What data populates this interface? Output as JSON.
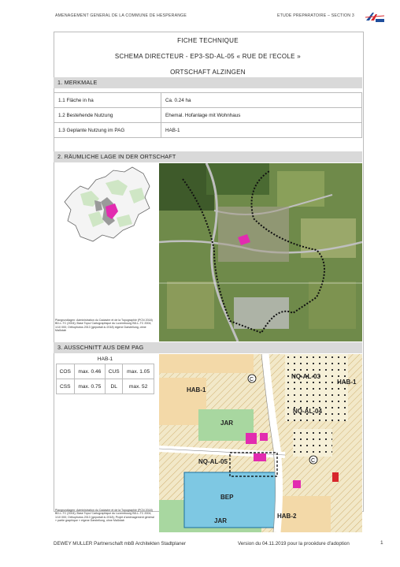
{
  "header": {
    "left": "AMENAGEMENT GENERAL DE LA COMMUNE DE HESPERANGE",
    "right": "ETUDE PREPARATOIRE – SECTION 3"
  },
  "title": {
    "line1": "FICHE TECHNIQUE",
    "line2": "SCHEMA DIRECTEUR - EP3-SD-AL-05 « RUE DE l'ECOLE »",
    "line3": "ORTSCHAFT ALZINGEN"
  },
  "sections": {
    "s1": "1. MERKMALE",
    "s2": "2. RÄUMLICHE LAGE IN DER ORTSCHAFT",
    "s3": "3. AUSSCHNITT AUS DEM PAG"
  },
  "merkmale": [
    {
      "label": "1.1 Fläche in ha",
      "value": "Ca. 0.24 ha"
    },
    {
      "label": "1.2 Bestehende Nutzung",
      "value": "Ehemal. Hofanlage mit Wohnhaus"
    },
    {
      "label": "1.3 Geplante Nutzung im PAG",
      "value": "HAB-1"
    }
  ],
  "captions": {
    "lage": "Plangrundlagen: Administration du Cadastre et de la Topographie (PCN 2018) BD-L-TC (2004); Base Topo/ Cartographique du Luxembourg BD-L-TC 2004, 1/10 000; Orthophotos 2013 (geportail.lu 2018) eigene Darstellung, ohne Maßstab",
    "pag": "Plangrundlagen: Administration du Cadastre et de la Topographie (PCN 2018) BD-L-TC (2004); Base Topo/ Cartographique du Luxembourg BD-L-TC 2004, 1/10 000; Orthophotos 2013 (geportail.lu 2018); Projet d'aménagement général « partie graphique » eigene Darstellung, ohne Maßstab"
  },
  "pag_table": {
    "zone": "HAB-1",
    "rows": [
      [
        "COS",
        "max. 0.46",
        "CUS",
        "max. 1.05"
      ],
      [
        "CSS",
        "max. 0.75",
        "DL",
        "max. 52"
      ]
    ]
  },
  "map_labels": {
    "hab1_a": "HAB-1",
    "hab1_b": "HAB-1",
    "jar_a": "JAR",
    "jar_b": "JAR",
    "nq03": "NQ-AL-03",
    "nq04": "NQ-AL-04",
    "nq05": "NQ-AL-05",
    "bep": "BEP",
    "hab2": "HAB-2",
    "c1": "C",
    "c2": "C"
  },
  "footer": {
    "left": "DEWEY MULLER Partnerschaft mbB Architekten Stadtplaner",
    "right": "Version du 04.11.2019 pour la procédure d'adoption",
    "page": "1"
  },
  "colors": {
    "section_bg": "#d9d9d9",
    "highlight": "#e22bb0",
    "hab": "#f0e6c8",
    "bep": "#7ec8e3",
    "jar": "#9ed09a"
  }
}
